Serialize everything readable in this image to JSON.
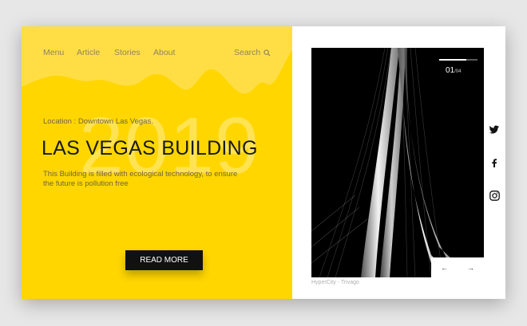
{
  "nav": {
    "items": [
      {
        "label": "Menu"
      },
      {
        "label": "Article"
      },
      {
        "label": "Stories"
      },
      {
        "label": "About"
      }
    ],
    "search_label": "Search"
  },
  "hero": {
    "year": "2019",
    "location": "Location : Downtown Las Vegas.",
    "title": "LAS VEGAS BUILDING",
    "description": "This Building is filled with ecological technology, to ensure the future is pollution free",
    "cta_label": "READ MORE"
  },
  "gallery": {
    "current": "01",
    "total": "/04",
    "progress": 0.7,
    "caption": "HyperCity - Trivago",
    "prev_symbol": "←",
    "next_symbol": "→"
  },
  "social": [
    "twitter-icon",
    "facebook-icon",
    "instagram-icon"
  ],
  "colors": {
    "accent": "#FFD600",
    "accent_light": "#FFDE45",
    "button": "#111111",
    "background": "#E7E7E7"
  }
}
